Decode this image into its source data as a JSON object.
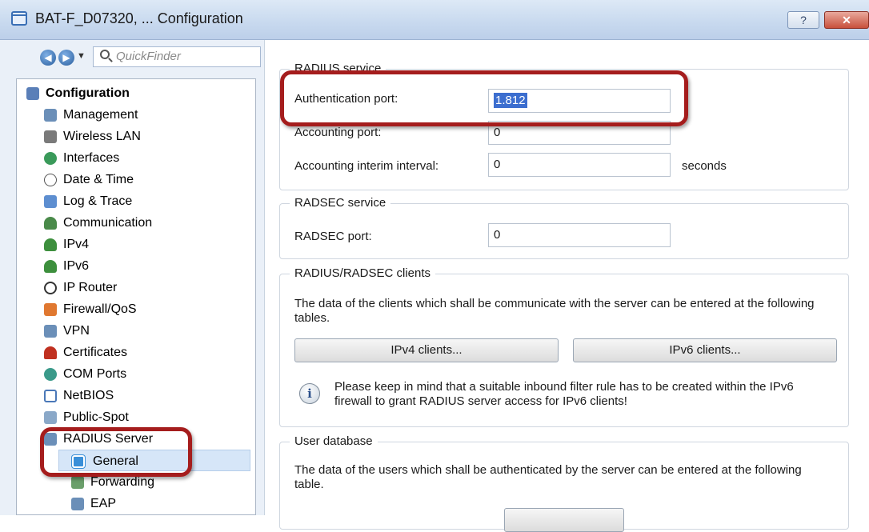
{
  "window": {
    "title": "BAT-F_D07320, ... Configuration",
    "help_label": "?",
    "close_label": "✕"
  },
  "nav": {
    "back_icon": "back-arrow-icon",
    "forward_icon": "forward-arrow-icon",
    "dropdown_label": "▼",
    "finder_placeholder": "QuickFinder"
  },
  "tree": [
    {
      "label": "Configuration",
      "icon": "configuration-icon",
      "color": "#5a7fb8"
    },
    {
      "label": "Management",
      "icon": "management-icon",
      "color": "#6b8fb8"
    },
    {
      "label": "Wireless LAN",
      "icon": "wireless-lan-icon",
      "color": "#7a7a7a"
    },
    {
      "label": "Interfaces",
      "icon": "interfaces-icon",
      "color": "#3a9a5a"
    },
    {
      "label": "Date & Time",
      "icon": "clock-icon",
      "color": "#ffffff"
    },
    {
      "label": "Log & Trace",
      "icon": "log-trace-icon",
      "color": "#5d8ed0"
    },
    {
      "label": "Communication",
      "icon": "communication-icon",
      "color": "#4a8a4a"
    },
    {
      "label": "IPv4",
      "icon": "ipv4-icon",
      "color": "#3d8f3d"
    },
    {
      "label": "IPv6",
      "icon": "ipv6-icon",
      "color": "#3d8f3d"
    },
    {
      "label": "IP Router",
      "icon": "ip-router-icon",
      "color": "#ffffff"
    },
    {
      "label": "Firewall/QoS",
      "icon": "firewall-icon",
      "color": "#e07830"
    },
    {
      "label": "VPN",
      "icon": "vpn-icon",
      "color": "#6b8fb8"
    },
    {
      "label": "Certificates",
      "icon": "certificates-icon",
      "color": "#c03020"
    },
    {
      "label": "COM Ports",
      "icon": "com-ports-icon",
      "color": "#3a9a8a"
    },
    {
      "label": "NetBIOS",
      "icon": "netbios-icon",
      "color": "#ffffff"
    },
    {
      "label": "Public-Spot",
      "icon": "public-spot-icon",
      "color": "#8aa8c8"
    },
    {
      "label": "RADIUS Server",
      "icon": "radius-server-icon",
      "color": "#6b8fb8"
    },
    {
      "label": "General",
      "icon": "general-icon",
      "color": "#3a8fd8"
    },
    {
      "label": "Forwarding",
      "icon": "forwarding-icon",
      "color": "#6b9f6b"
    },
    {
      "label": "EAP",
      "icon": "eap-icon",
      "color": "#6b8fb8"
    }
  ],
  "radius": {
    "title": "RADIUS service",
    "auth_label": "Authentication port:",
    "auth_value": "1.812",
    "acct_label": "Accounting port:",
    "acct_value": "0",
    "interim_label": "Accounting interim interval:",
    "interim_value": "0",
    "interim_unit": "seconds"
  },
  "radsec": {
    "title": "RADSEC service",
    "port_label": "RADSEC port:",
    "port_value": "0"
  },
  "clients": {
    "title": "RADIUS/RADSEC clients",
    "description": "The data of the clients which shall be communicate with the server can be entered at the following tables.",
    "ipv4_button": "IPv4 clients...",
    "ipv6_button": "IPv6 clients...",
    "info_icon": "info-icon",
    "info_text": "Please keep in mind that a suitable inbound filter rule has to be created within the IPv6 firewall to grant RADIUS server access for IPv6 clients!"
  },
  "users": {
    "title": "User database",
    "description": "The data of the users which shall be authenticated by the server can be entered at the following table."
  },
  "colors": {
    "highlight": "#a51d1d",
    "selection": "#3c6ecf"
  }
}
